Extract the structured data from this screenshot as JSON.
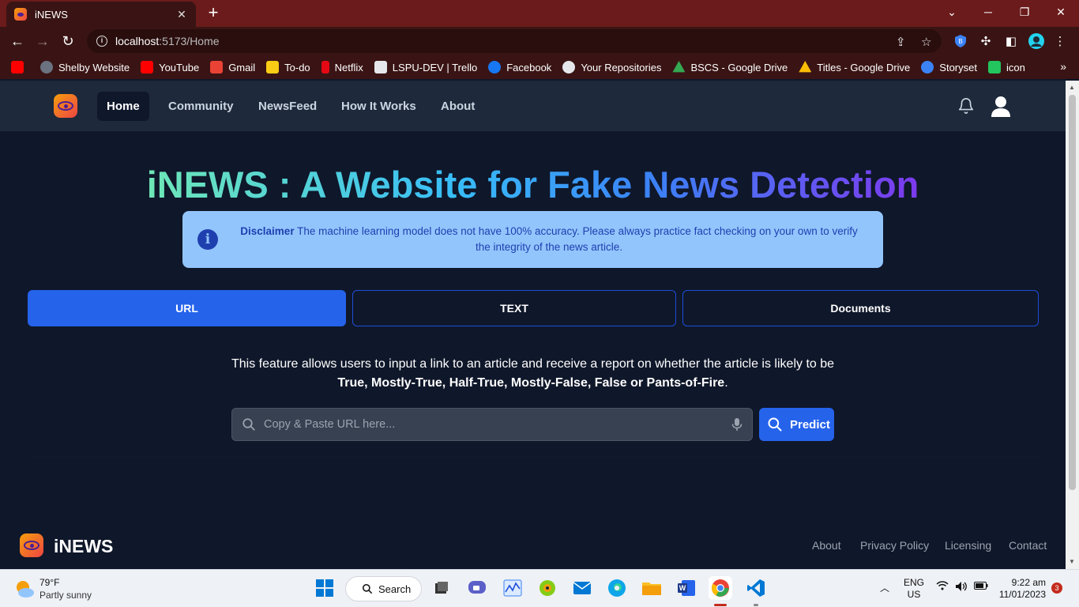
{
  "browser": {
    "tab_title": "iNEWS",
    "tab_close": "✕",
    "new_tab": "+",
    "url_host": "localhost",
    "url_path": ":5173/Home",
    "bookmarks": [
      {
        "label": "Shelby Website",
        "color": "#6b7280"
      },
      {
        "label": "YouTube",
        "color": "#ff0000"
      },
      {
        "label": "Gmail",
        "color": "#ea4335"
      },
      {
        "label": "To-do",
        "color": "#facc15"
      },
      {
        "label": "Netflix",
        "color": "#e50914"
      },
      {
        "label": "LSPU-DEV | Trello",
        "color": "#e5e7eb"
      },
      {
        "label": "Facebook",
        "color": "#1877f2"
      },
      {
        "label": "Your Repositories",
        "color": "#e5e7eb"
      },
      {
        "label": "BSCS - Google Drive",
        "color": "#34a853"
      },
      {
        "label": "Titles - Google Drive",
        "color": "#fbbc04"
      },
      {
        "label": "Storyset",
        "color": "#3b82f6"
      },
      {
        "label": "icon",
        "color": "#22c55e"
      }
    ],
    "more_bookmarks": "»"
  },
  "nav": {
    "items": [
      "Home",
      "Community",
      "NewsFeed",
      "How It Works",
      "About"
    ],
    "active": "Home"
  },
  "hero": {
    "title": "iNEWS : A Website for Fake News Detection"
  },
  "disclaimer": {
    "label": "Disclaimer",
    "text": " The machine learning model does not have 100% accuracy. Please always practice fact checking on your own to verify the integrity of the news article."
  },
  "input_tabs": {
    "url": "URL",
    "text": "TEXT",
    "documents": "Documents",
    "active": "URL"
  },
  "feature": {
    "description": "This feature allows users to input a link to an article and receive a report on whether the article is likely to be",
    "categories": "True, Mostly-True, Half-True, Mostly-False, False or Pants-of-Fire",
    "period": "."
  },
  "search": {
    "placeholder": "Copy & Paste URL here...",
    "value": "",
    "button": "Predict"
  },
  "footer": {
    "brand": "iNEWS",
    "links": [
      "About",
      "Privacy Policy",
      "Licensing",
      "Contact"
    ]
  },
  "taskbar": {
    "temperature": "79°F",
    "condition": "Partly sunny",
    "search": "Search",
    "lang_1": "ENG",
    "lang_2": "US",
    "time": "9:22 am",
    "date": "11/01/2023",
    "notifications": "3"
  },
  "colors": {
    "accent": "#2563eb",
    "page_bg": "#0f172a",
    "nav_bg": "#1e293b",
    "alert_bg": "#93c5fd",
    "alert_text": "#1e40af",
    "browser_frame": "#6b1b1b"
  }
}
